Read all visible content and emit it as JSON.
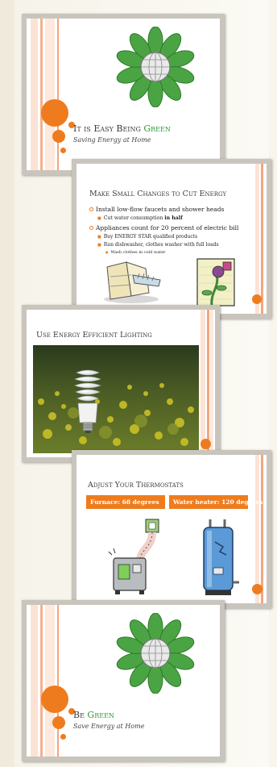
{
  "slides": [
    {
      "title_main": "It is Easy Being ",
      "title_accent": "Green",
      "subtitle": "Saving Energy at Home"
    },
    {
      "title": "Make Small Changes to Cut Energy",
      "bullets": [
        {
          "text": "Install low-flow faucets and shower heads",
          "level": 1
        },
        {
          "text": "Cut water consumption ",
          "bold": "in half",
          "level": 2
        },
        {
          "text": "Appliances count for 20 percent of electric bill",
          "level": 1
        },
        {
          "text": "Buy ENERGY STAR qualified products",
          "level": 2
        },
        {
          "text": "Run dishwasher, clothes washer with full loads",
          "level": 2
        },
        {
          "text": "Wash clothes in cold water",
          "level": 3
        }
      ]
    },
    {
      "title": "Use Energy Efficient Lighting"
    },
    {
      "title": "Adjust Your Thermostats",
      "boxes": [
        "Furnace: 68 degrees",
        "Water heater: 120 degrees"
      ]
    },
    {
      "title_main": "Be ",
      "title_accent": "Green",
      "subtitle": "Save Energy at Home"
    }
  ],
  "colors": {
    "accent": "#ee7c1e",
    "green": "#2f9a38",
    "frame": "#c9c5bd"
  }
}
